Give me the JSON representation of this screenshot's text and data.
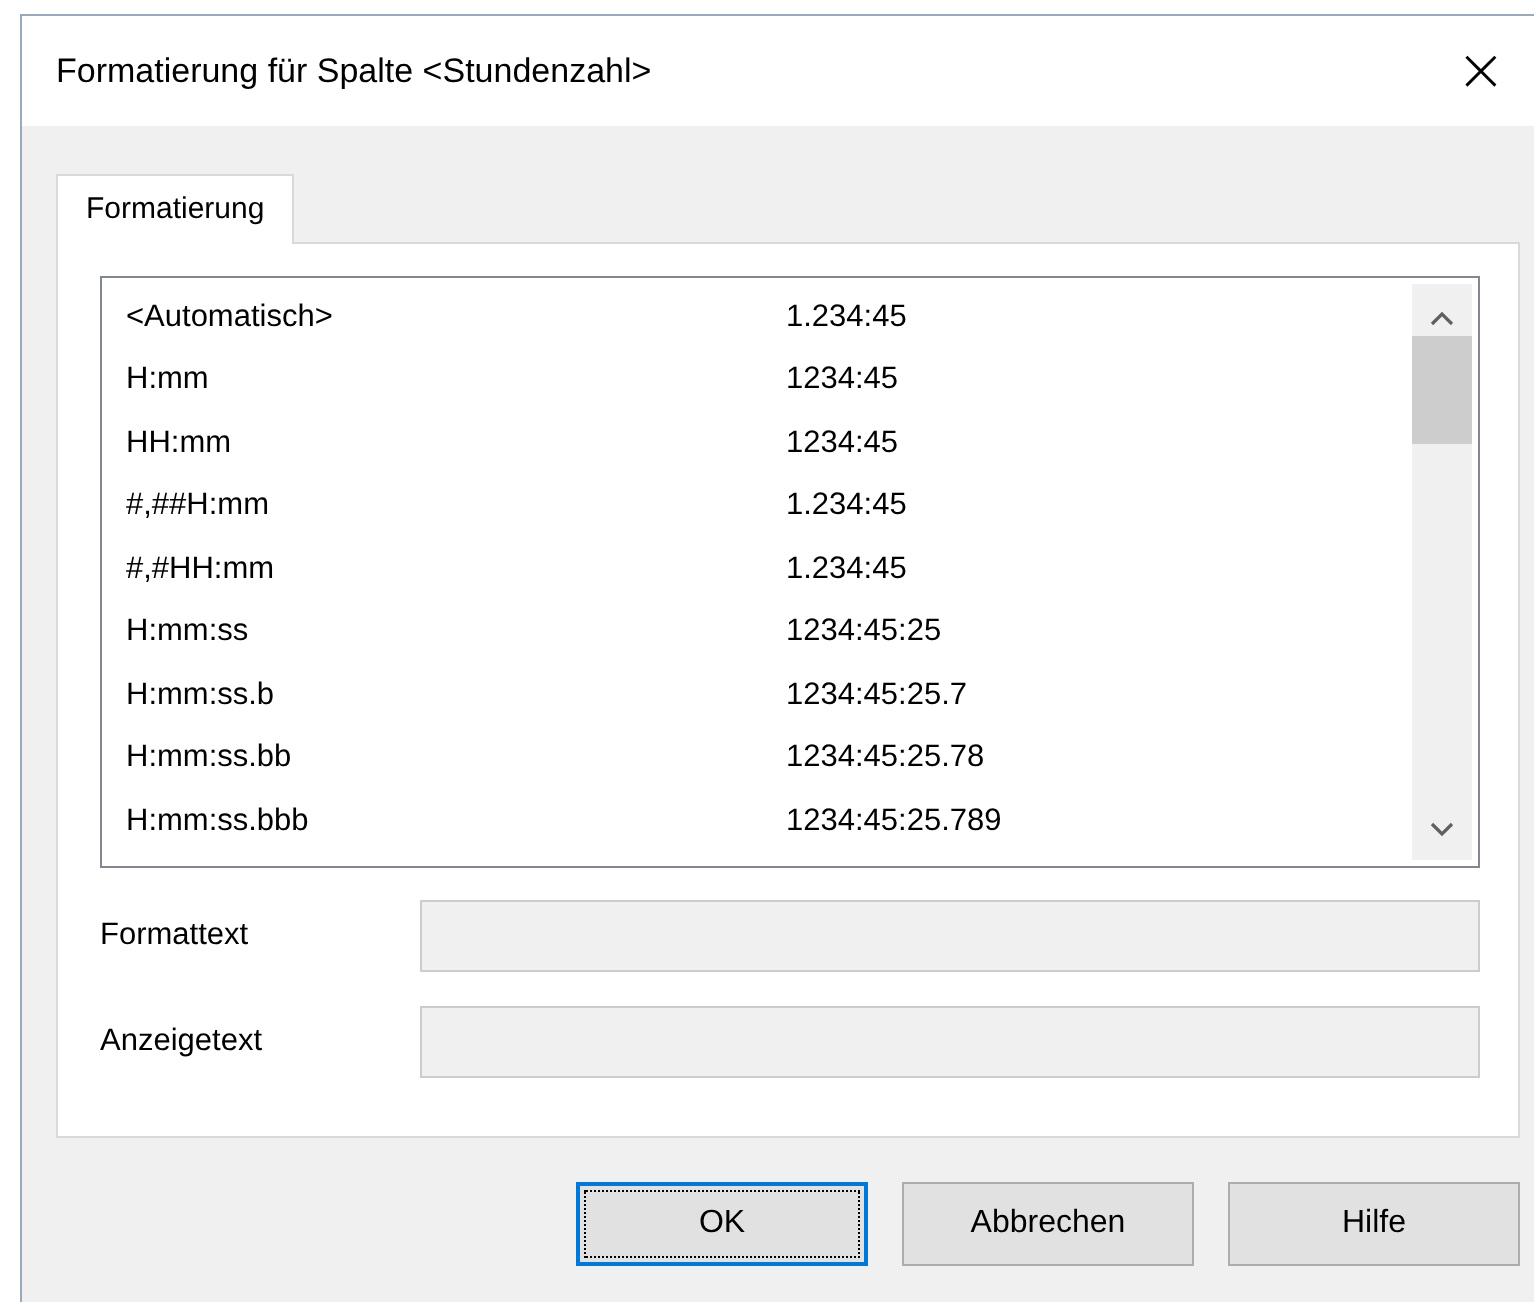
{
  "window": {
    "title": "Formatierung für Spalte <Stundenzahl>",
    "close": "×"
  },
  "tabs": [
    {
      "label": "Formatierung",
      "selected": true
    }
  ],
  "formats": [
    {
      "format": "<Automatisch>",
      "example": "1.234:45"
    },
    {
      "format": "H:mm",
      "example": "1234:45"
    },
    {
      "format": "HH:mm",
      "example": "1234:45"
    },
    {
      "format": "#,##H:mm",
      "example": "1.234:45"
    },
    {
      "format": "#,#HH:mm",
      "example": "1.234:45"
    },
    {
      "format": "H:mm:ss",
      "example": "1234:45:25"
    },
    {
      "format": "H:mm:ss.b",
      "example": "1234:45:25.7"
    },
    {
      "format": "H:mm:ss.bb",
      "example": "1234:45:25.78"
    },
    {
      "format": "H:mm:ss.bbb",
      "example": "1234:45:25.789"
    }
  ],
  "fields": [
    {
      "label": "Formattext",
      "disabled": true
    },
    {
      "label": "Anzeigetext",
      "disabled": true
    }
  ],
  "buttons": [
    {
      "label": "OK",
      "focused": true
    },
    {
      "label": "Abbrechen",
      "focused": false
    },
    {
      "label": "Hilfe",
      "focused": false
    }
  ]
}
